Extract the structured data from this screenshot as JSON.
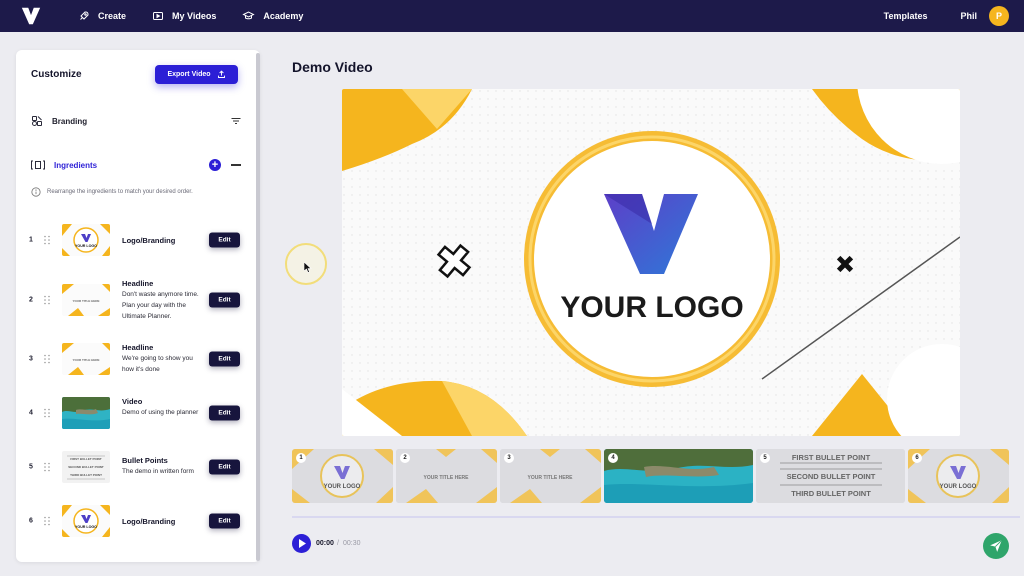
{
  "nav": {
    "items": [
      {
        "label": "Create",
        "icon": "rocket-icon"
      },
      {
        "label": "My Videos",
        "icon": "video-icon"
      },
      {
        "label": "Academy",
        "icon": "graduation-cap-icon"
      }
    ],
    "templates": "Templates",
    "user_name": "Phil",
    "avatar_initial": "P"
  },
  "sidebar": {
    "title": "Customize",
    "export_label": "Export Video",
    "branding_label": "Branding",
    "ingredients_label": "Ingredients",
    "info_text": "Rearrange the ingredients to match your desired order.",
    "edit_label": "Edit",
    "items": [
      {
        "num": "1",
        "title": "Logo/Branding",
        "desc": "",
        "thumb": "logo"
      },
      {
        "num": "2",
        "title": "Headline",
        "desc": "Don't waste anymore time. Plan your day with the Ultimate Planner.",
        "thumb": "title"
      },
      {
        "num": "3",
        "title": "Headline",
        "desc": "We're going to show you how it's done",
        "thumb": "title"
      },
      {
        "num": "4",
        "title": "Video",
        "desc": "Demo of using the planner",
        "thumb": "video"
      },
      {
        "num": "5",
        "title": "Bullet Points",
        "desc": "The demo in written form",
        "thumb": "bullets"
      },
      {
        "num": "6",
        "title": "Logo/Branding",
        "desc": "",
        "thumb": "logo"
      }
    ]
  },
  "main": {
    "title": "Demo Video",
    "preview_logo_text": "YOUR LOGO"
  },
  "timeline": {
    "clips": [
      {
        "num": "1",
        "type": "logo",
        "text": "YOUR LOGO"
      },
      {
        "num": "2",
        "type": "title",
        "text": "YOUR TITLE HERE"
      },
      {
        "num": "3",
        "type": "title",
        "text": "YOUR TITLE HERE"
      },
      {
        "num": "4",
        "type": "video",
        "text": ""
      },
      {
        "num": "5",
        "type": "bullets",
        "lines": [
          "FIRST BULLET POINT",
          "SECOND BULLET POINT",
          "THIRD BULLET POINT"
        ]
      },
      {
        "num": "6",
        "type": "logo",
        "text": "YOUR LOGO"
      }
    ]
  },
  "player": {
    "current": "00:00",
    "separator": "/",
    "total": "00:30"
  },
  "thumb_text": {
    "logo": "YOUR LOGO",
    "title": "YOUR TITLE HERE",
    "bullets": [
      "FIRST BULLET POINT",
      "SECOND BULLET POINT",
      "THIRD BULLET POINT"
    ]
  },
  "colors": {
    "topbar": "#1d1a4a",
    "accent": "#2c1fd6",
    "edit_button": "#17153d",
    "yellow": "#f5b51e",
    "send": "#2fa56b"
  }
}
